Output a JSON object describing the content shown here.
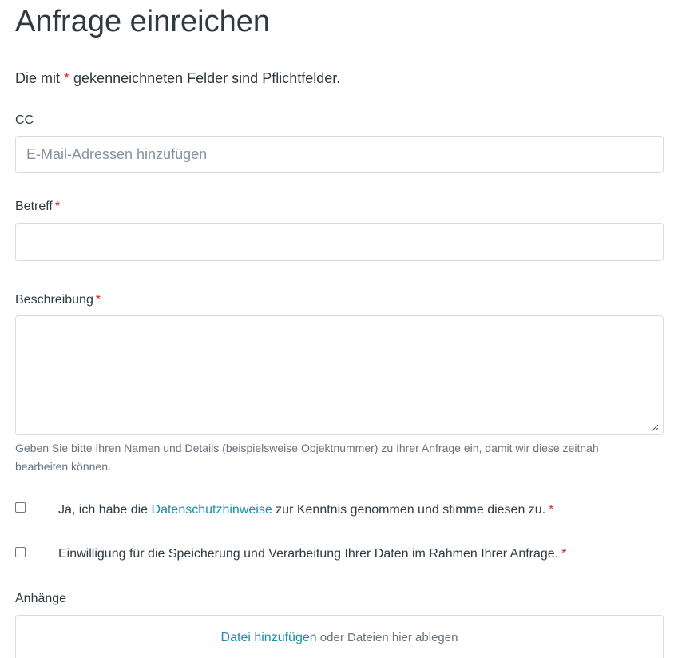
{
  "form": {
    "title": "Anfrage einreichen",
    "intro_before": "Die mit ",
    "intro_star": "*",
    "intro_after": " gekenneichneten Felder sind Pflichtfelder.",
    "required_marker": "*",
    "cc": {
      "label": "CC",
      "placeholder": "E-Mail-Adressen hinzufügen",
      "value": ""
    },
    "subject": {
      "label": "Betreff",
      "value": ""
    },
    "description": {
      "label": "Beschreibung",
      "value": "",
      "hint": "Geben Sie bitte Ihren Namen und Details (beispielsweise Objektnummer) zu Ihrer Anfrage ein, damit wir diese zeitnah bearbeiten können."
    },
    "privacy": {
      "text_before": "Ja, ich habe die ",
      "link_text": "Datenschutzhinweise",
      "text_after": " zur Kenntnis genommen und stimme diesen zu.",
      "checked": false
    },
    "consent": {
      "text": "Einwilligung für die Speicherung und Verarbeitung Ihrer Daten im Rahmen Ihrer Anfrage.",
      "checked": false
    },
    "attachments": {
      "label": "Anhänge",
      "add_link": "Datei hinzufügen",
      "drop_text": " oder Dateien hier ablegen"
    }
  },
  "colors": {
    "required": "#e02424",
    "link": "#1a8fa8",
    "text": "#2f3941",
    "muted": "#68737d",
    "border": "#d8dcde"
  }
}
